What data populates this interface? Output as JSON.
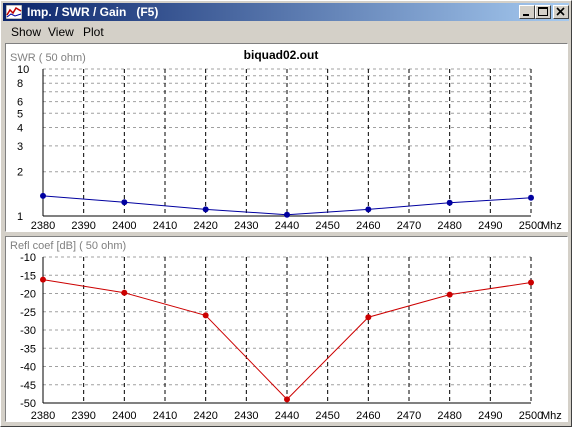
{
  "window": {
    "title": "Imp. / SWR / Gain   (F5)",
    "app_icon": "chart-icon",
    "controls": [
      "minimize-icon",
      "maximize-icon",
      "close-icon"
    ]
  },
  "menu": {
    "show": "Show",
    "view": "View",
    "plot": "Plot"
  },
  "chart_data": [
    {
      "type": "line",
      "title": "biquad02.out",
      "ylabel": "SWR ( 50 ohm)",
      "xunit": "Mhz",
      "x": [
        2380,
        2400,
        2420,
        2440,
        2460,
        2480,
        2500
      ],
      "series": [
        {
          "values": [
            1.37,
            1.24,
            1.11,
            1.02,
            1.11,
            1.23,
            1.33
          ],
          "color": "#0000a0"
        }
      ],
      "xticks": [
        "2380",
        "2390",
        "2400",
        "2410",
        "2420",
        "2430",
        "2440",
        "2450",
        "2460",
        "2470",
        "2480",
        "2490",
        "2500"
      ],
      "yticks": [
        "1",
        "2",
        "3",
        "4",
        "5",
        "6",
        "8",
        "10"
      ],
      "ylim": [
        1,
        10
      ],
      "yscale": "log",
      "grid": true
    },
    {
      "type": "line",
      "ylabel": "Refl coef [dB] ( 50 ohm)",
      "xunit": "Mhz",
      "x": [
        2380,
        2400,
        2420,
        2440,
        2460,
        2480,
        2500
      ],
      "series": [
        {
          "values": [
            -16.2,
            -19.8,
            -26.0,
            -49.0,
            -26.5,
            -20.3,
            -17.0
          ],
          "color": "#cc0000"
        }
      ],
      "xticks": [
        "2380",
        "2390",
        "2400",
        "2410",
        "2420",
        "2430",
        "2440",
        "2450",
        "2460",
        "2470",
        "2480",
        "2490",
        "2500"
      ],
      "yticks": [
        "-10",
        "-15",
        "-20",
        "-25",
        "-30",
        "-35",
        "-40",
        "-45",
        "-50"
      ],
      "ylim": [
        -50,
        -10
      ],
      "yscale": "linear",
      "grid": true
    }
  ]
}
